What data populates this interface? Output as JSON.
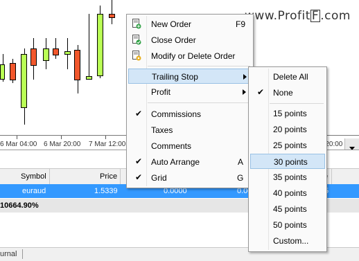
{
  "watermark": {
    "pre": "www.Profit",
    "f": "F",
    "post": ".com"
  },
  "chart": {
    "x_labels": [
      "6 Mar 04:00",
      "6 Mar 20:00",
      "7 Mar 12:00",
      "8 Mar 20:00"
    ],
    "colors": {
      "bull": "#b9ff55",
      "bear": "#f2572c"
    }
  },
  "table": {
    "headers": {
      "symbol": "Symbol",
      "price": "Price",
      "partial": "e"
    },
    "row": {
      "symbol": "euraud",
      "price": "1.5339",
      "value1": "0.0000",
      "value2": "0.00",
      "partial": "5"
    },
    "total": "10664.90%"
  },
  "bottom": {
    "tab": "urnal"
  },
  "context_menu": {
    "new_order": {
      "label": "New Order",
      "shortcut": "F9"
    },
    "close_order": {
      "label": "Close Order"
    },
    "modify_order": {
      "label": "Modify or Delete Order"
    },
    "trailing_stop": {
      "label": "Trailing Stop"
    },
    "profit": {
      "label": "Profit"
    },
    "commissions": {
      "label": "Commissions"
    },
    "taxes": {
      "label": "Taxes"
    },
    "comments": {
      "label": "Comments"
    },
    "auto_arrange": {
      "label": "Auto Arrange",
      "shortcut": "A"
    },
    "grid": {
      "label": "Grid",
      "shortcut": "G"
    }
  },
  "submenu": {
    "items": [
      "Delete All",
      "None",
      "15 points",
      "20 points",
      "25 points",
      "30 points",
      "35 points",
      "40 points",
      "45 points",
      "50 points",
      "Custom..."
    ]
  }
}
